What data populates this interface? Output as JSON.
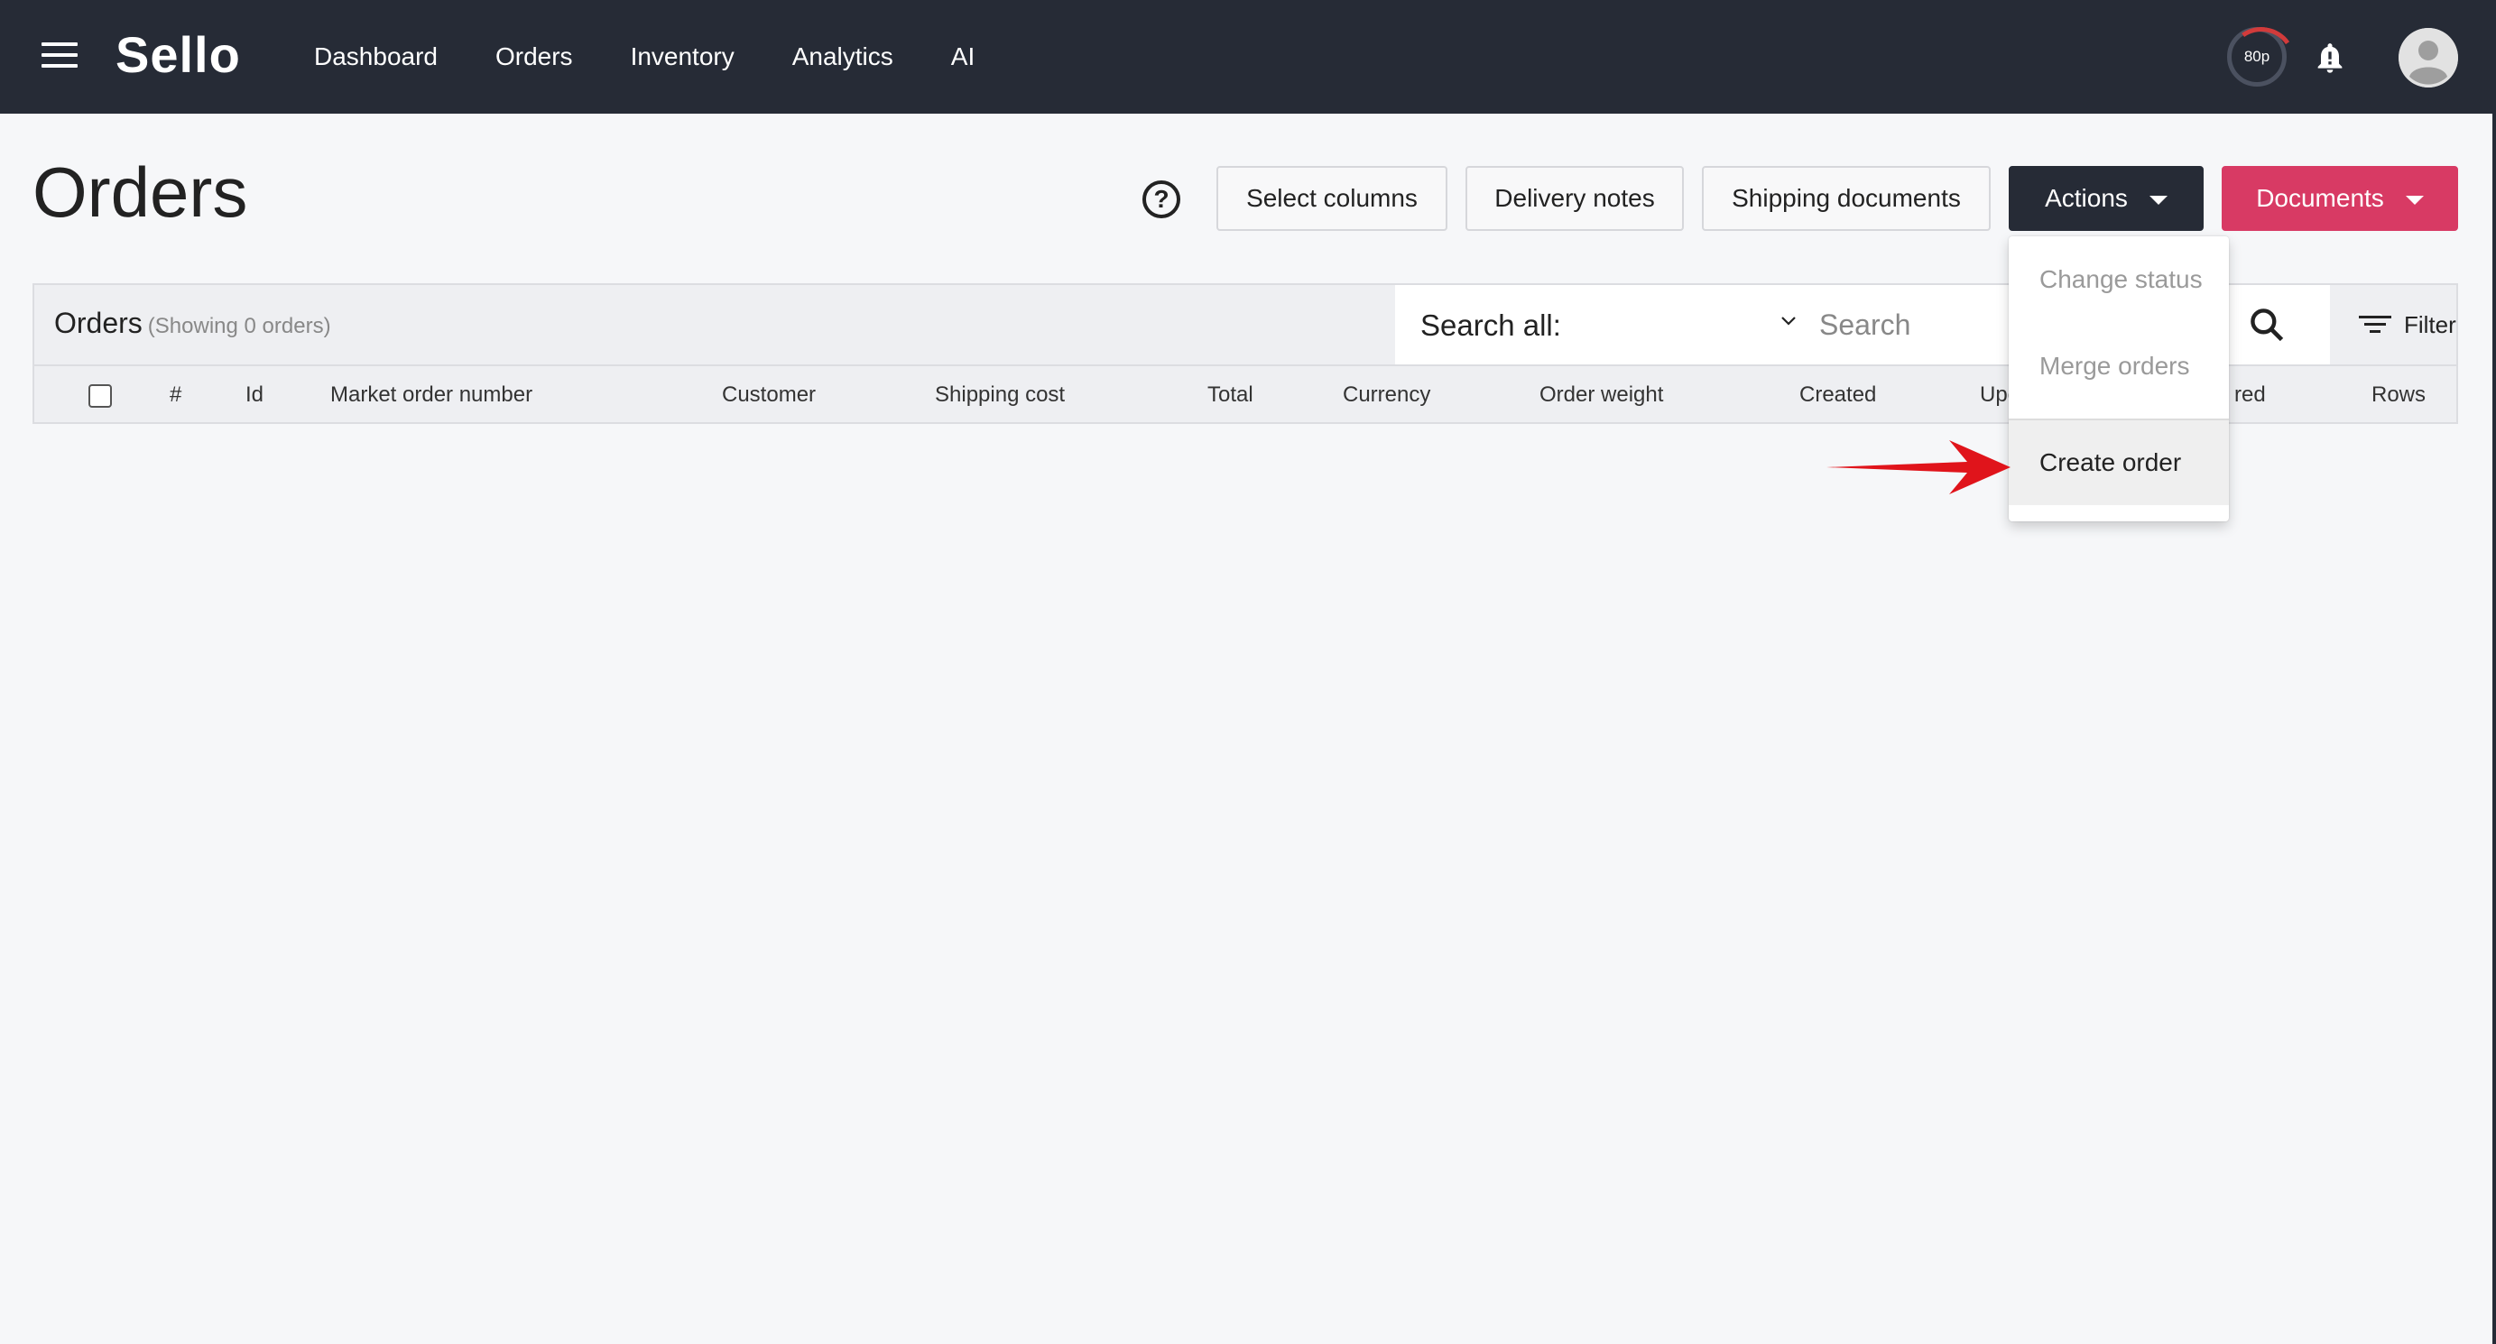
{
  "app": {
    "name": "Sello"
  },
  "nav": {
    "items": [
      "Dashboard",
      "Orders",
      "Inventory",
      "Analytics",
      "AI"
    ]
  },
  "top_right": {
    "speed_label": "80p"
  },
  "page": {
    "title": "Orders"
  },
  "toolbar": {
    "select_columns": "Select columns",
    "delivery_notes": "Delivery notes",
    "shipping_documents": "Shipping documents",
    "actions": "Actions",
    "documents": "Documents"
  },
  "actions_menu": {
    "items": [
      {
        "label": "Change status",
        "disabled": true
      },
      {
        "label": "Merge orders",
        "disabled": true
      },
      {
        "label": "Create order",
        "disabled": false
      }
    ]
  },
  "panel": {
    "title": "Orders",
    "subtitle": "(Showing 0 orders)",
    "search_scope": "Search all:",
    "search_placeholder": "Search",
    "filter_label": "Filter"
  },
  "table": {
    "columns": [
      "#",
      "Id",
      "Market order number",
      "Customer",
      "Shipping cost",
      "Total",
      "Currency",
      "Order weight",
      "Created",
      "Upc",
      "red",
      "Rows"
    ],
    "rows": []
  },
  "colors": {
    "topbar": "#262b36",
    "actions_button": "#262b36",
    "documents_button": "#d83a64",
    "annotation_arrow": "#e0141b"
  }
}
